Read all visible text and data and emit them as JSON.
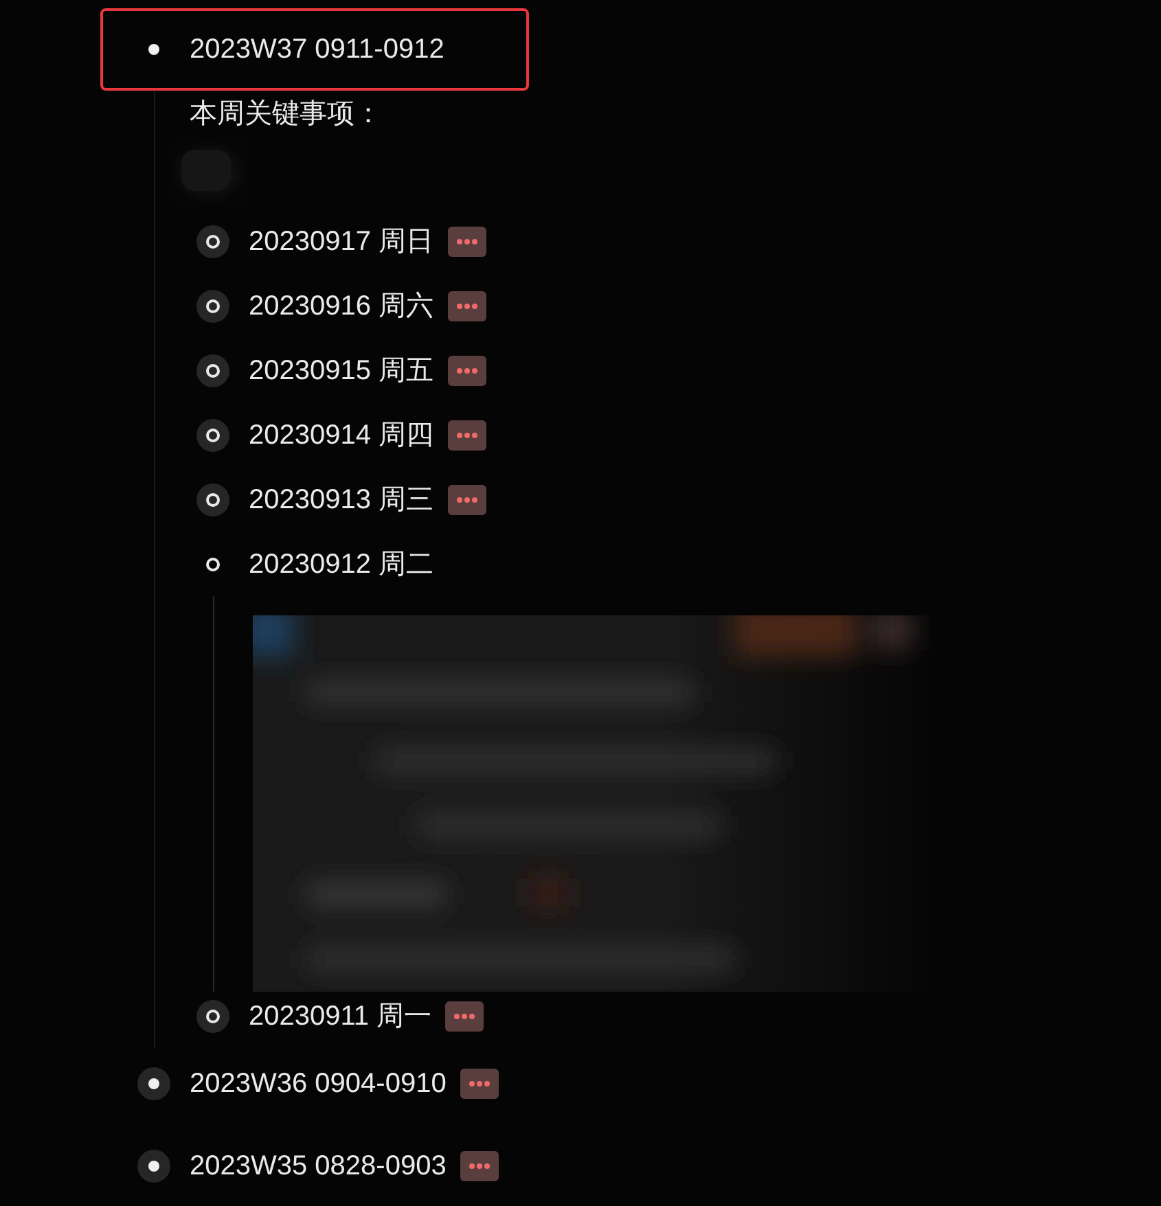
{
  "blocks": [
    {
      "title": "2023W37 0911-0912",
      "highlighted": true,
      "collapsed": false,
      "body": [
        {
          "kind": "text",
          "text": "本周关键事项："
        },
        {
          "kind": "picture"
        }
      ],
      "children": [
        {
          "title": "20230917 周日",
          "collapsed": true
        },
        {
          "title": "20230916 周六",
          "collapsed": true
        },
        {
          "title": "20230915 周五",
          "collapsed": true
        },
        {
          "title": "20230914 周四",
          "collapsed": true
        },
        {
          "title": "20230913 周三",
          "collapsed": true
        },
        {
          "title": "20230912 周二",
          "collapsed": false,
          "children": [
            {
              "kind": "picture"
            }
          ]
        },
        {
          "title": "20230911 周一",
          "collapsed": true
        }
      ]
    },
    {
      "title": "2023W36 0904-0910",
      "highlighted": false,
      "collapsed": true
    },
    {
      "title": "2023W35 0828-0903",
      "highlighted": false,
      "collapsed": true
    }
  ]
}
